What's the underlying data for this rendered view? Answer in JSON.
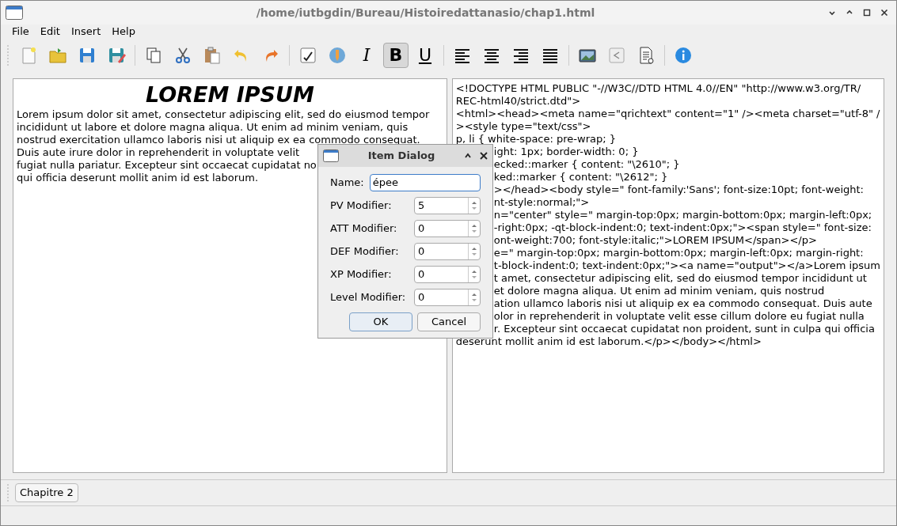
{
  "window": {
    "title": "/home/iutbgdin/Bureau/Histoiredattanasio/chap1.html"
  },
  "menu": [
    "File",
    "Edit",
    "Insert",
    "Help"
  ],
  "format_buttons": [
    {
      "label": "I",
      "selected": false
    },
    {
      "label": "B",
      "selected": true
    },
    {
      "label": "U",
      "selected": false
    }
  ],
  "editor": {
    "heading": "LOREM IPSUM",
    "lines": [
      "Lorem ipsum dolor sit amet, consectetur adipiscing elit, sed do eiusmod tempor",
      "incididunt ut labore et dolore magna aliqua. Ut enim ad minim veniam, quis",
      "nostrud exercitation ullamco laboris nisi ut aliquip ex ea commodo consequat.",
      "Duis aute irure dolor in reprehenderit in voluptate velit",
      "fugiat nulla pariatur. Excepteur sint occaecat cupidatat no",
      "qui officia deserunt mollit anim id est laborum."
    ]
  },
  "source": {
    "lines": [
      {
        "text": "<!DOCTYPE HTML PUBLIC \"-//W3C//DTD HTML 4.0//EN\" \"http://www.w3.org/TR/",
        "cut": false
      },
      {
        "text": "REC-html40/strict.dtd\">",
        "cut": false
      },
      {
        "text": "<html><head><meta name=\"qrichtext\" content=\"1\" /><meta charset=\"utf-8\" /",
        "cut": false
      },
      {
        "text": "><style type=\"text/css\">",
        "cut": false
      },
      {
        "text": "p, li { white-space: pre-wrap; }",
        "cut": false
      },
      {
        "text": "ight: 1px; border-width: 0; }",
        "cut": true
      },
      {
        "text": "ecked::marker { content: \"\\2610\"; }",
        "cut": true
      },
      {
        "text": "ked::marker { content: \"\\2612\"; }",
        "cut": true
      },
      {
        "text": "></head><body style=\" font-family:'Sans'; font-size:10pt; font-weight:",
        "cut": true
      },
      {
        "text": "nt-style:normal;\">",
        "cut": true
      },
      {
        "text": "n=\"center\" style=\" margin-top:0px; margin-bottom:0px; margin-left:0px;",
        "cut": true
      },
      {
        "text": "-right:0px; -qt-block-indent:0; text-indent:0px;\"><span style=\" font-size:",
        "cut": true
      },
      {
        "text": "ont-weight:700; font-style:italic;\">LOREM IPSUM</span></p>",
        "cut": true
      },
      {
        "text": "e=\" margin-top:0px; margin-bottom:0px; margin-left:0px; margin-right:",
        "cut": true
      },
      {
        "text": "t-block-indent:0; text-indent:0px;\"><a name=\"output\"></a>Lorem ipsum",
        "cut": true
      },
      {
        "text": "t amet, consectetur adipiscing elit, sed do eiusmod tempor incididunt ut",
        "cut": true
      },
      {
        "text": "et dolore magna aliqua. Ut enim ad minim veniam, quis nostrud",
        "cut": true
      },
      {
        "text": "ation ullamco laboris nisi ut aliquip ex ea commodo consequat. Duis aute",
        "cut": true
      },
      {
        "text": "olor in reprehenderit in voluptate velit esse cillum dolore eu fugiat nulla",
        "cut": true
      },
      {
        "text": "r. Excepteur sint occaecat cupidatat non proident, sunt in culpa qui officia",
        "cut": true
      },
      {
        "text": "deserunt mollit anim id est laborum.</p></body></html>",
        "cut": false
      }
    ]
  },
  "dialog": {
    "title": "Item Dialog",
    "name_label": "Name:",
    "name_value": "épee",
    "fields": [
      {
        "label": "PV Modifier:",
        "value": "5"
      },
      {
        "label": "ATT Modifier:",
        "value": "0"
      },
      {
        "label": "DEF Modifier:",
        "value": "0"
      },
      {
        "label": "XP Modifier:",
        "value": "0"
      },
      {
        "label": "Level Modifier:",
        "value": "0"
      }
    ],
    "buttons": [
      "OK",
      "Cancel"
    ]
  },
  "chapters": [
    "Chapitre 2"
  ]
}
